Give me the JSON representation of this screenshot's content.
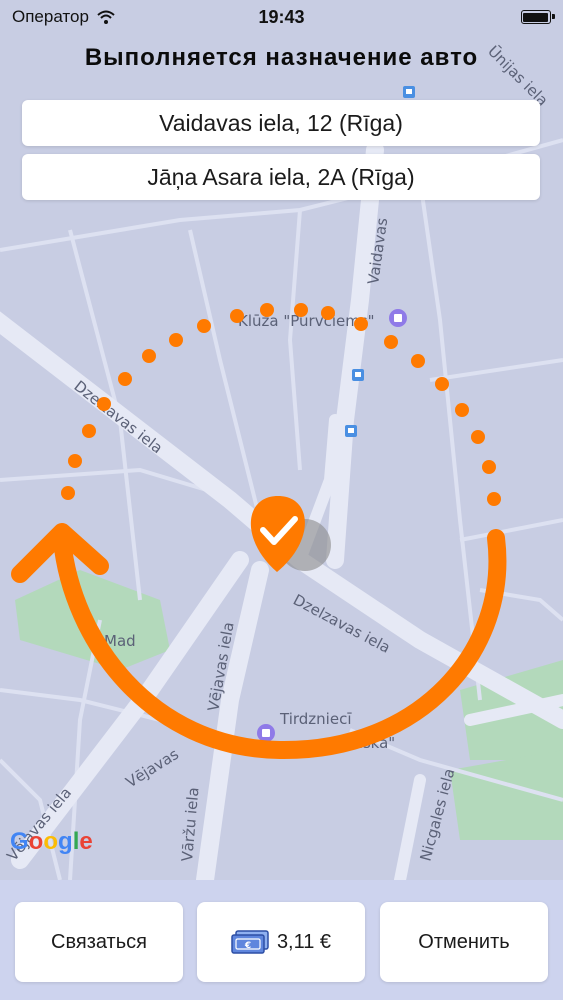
{
  "status_bar": {
    "carrier": "Оператор",
    "time": "19:43",
    "icons": [
      "wifi-icon",
      "battery-icon"
    ]
  },
  "page": {
    "title": "Выполняется назначение авто"
  },
  "route": {
    "from": "Vaidavas iela, 12 (Rīga)",
    "to": "Jāņa Asara iela, 2A (Rīga)"
  },
  "map": {
    "labels": {
      "dzelzavas_1": "Dzelzavas iela",
      "dzelzavas_2": "Dzelzavas iela",
      "vaidavas": "Vaidavas",
      "vejavas_1": "Vējavas iela",
      "vejavas_2": "Vējavas",
      "varzu": "Vāržu iela",
      "vejavas_3": "Vējavas iela",
      "nicgales": "Nicgales iela",
      "ozolu": "Ūnijas iela",
      "poi_shop": "Klūža \"Purvciems\"",
      "poi_mall_1": "Tirdzniecī",
      "poi_mall_2": "iinska\"",
      "mad": "Mad"
    },
    "attribution": "Google",
    "colors": {
      "accent": "#ff7a00",
      "map_bg": "#c8cde3",
      "road": "#e6e9f5",
      "park": "#b3d9bb"
    }
  },
  "actions": {
    "contact": "Связаться",
    "price": "3,11 €",
    "cancel": "Отменить"
  }
}
